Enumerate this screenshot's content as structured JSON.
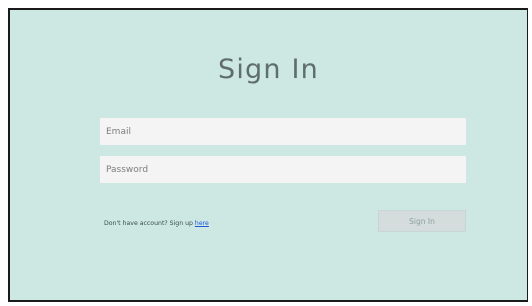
{
  "form": {
    "title": "Sign In",
    "email_placeholder": "Email",
    "password_placeholder": "Password",
    "signup_prompt": "Don't have account? Sign up",
    "signup_link": "here",
    "submit_label": "Sign In"
  },
  "colors": {
    "background": "#cde8e3",
    "input_background": "#f4f4f4",
    "title_text": "#5f6e6c",
    "link": "#1f57d6",
    "button_background": "#d5dcdc",
    "button_text": "#8aa0a0"
  }
}
